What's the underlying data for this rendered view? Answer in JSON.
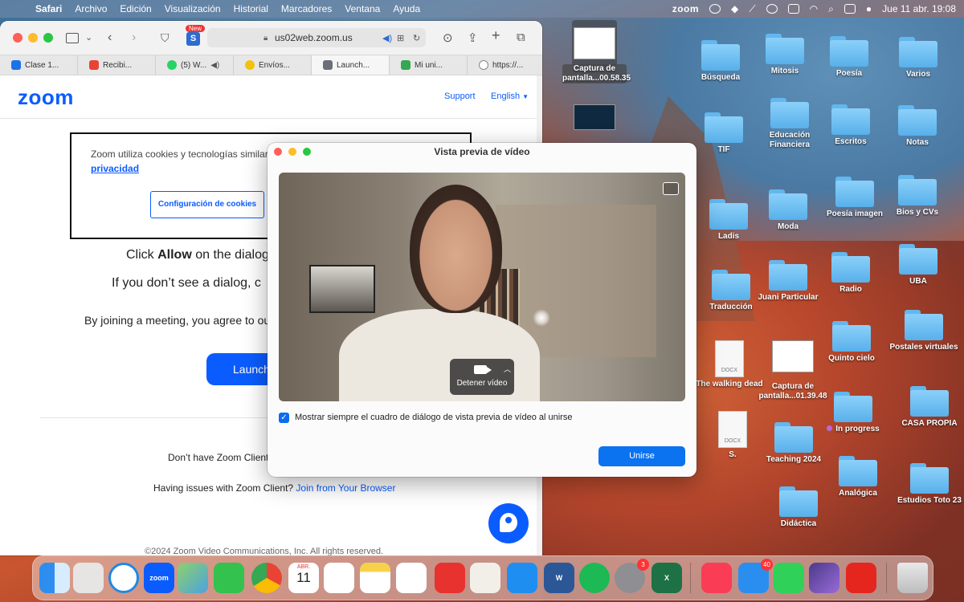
{
  "menubar": {
    "app": "Safari",
    "items": [
      "Archivo",
      "Edición",
      "Visualización",
      "Historial",
      "Marcadores",
      "Ventana",
      "Ayuda"
    ],
    "zoom_label": "zoom",
    "date_time": "Jue 11 abr.  19:08"
  },
  "safari": {
    "new_badge": "New",
    "address": "us02web.zoom.us",
    "tabs": [
      {
        "label": "Clase 1...",
        "favicon_color": "#1a73e8"
      },
      {
        "label": "Recibi...",
        "favicon_color": "#ea4335"
      },
      {
        "label": "(5) W...",
        "favicon_color": "#25d366"
      },
      {
        "label": "Envíos...",
        "favicon_color": "#f4c20d"
      },
      {
        "label": "Launch...",
        "favicon_color": "#6b6f77"
      },
      {
        "label": "Mi uni...",
        "favicon_color": "#34a853"
      },
      {
        "label": "https://...",
        "favicon_color": "#888888"
      }
    ]
  },
  "zoom_page": {
    "logo": "zoom",
    "support": "Support",
    "english": "English",
    "cookie_text": "Zoom utiliza cookies y tecnologías similares",
    "cookie_link": "privacidad",
    "cookie_button": "Configuración de cookies",
    "click_prefix": "Click ",
    "click_bold": "Allow",
    "click_suffix": " on the dialog",
    "no_dialog": "If you don’t see a dialog, c",
    "joining": "By joining a meeting, you agree to our",
    "launch": "Launch",
    "dont_have": "Don’t have Zoom Client",
    "issues_prefix": "Having issues with Zoom Client? ",
    "issues_link": "Join from Your Browser",
    "copyright": "©2024 Zoom Video Communications, Inc. All rights reserved."
  },
  "video_preview": {
    "title": "Vista previa de vídeo",
    "stop_video": "Detener vídeo",
    "always_show": "Mostrar siempre el cuadro de diálogo de vista previa de vídeo al unirse",
    "always_show_checked": true,
    "join": "Unirse"
  },
  "desktop": {
    "screenshot1": "Captura de pantalla...00.58.35",
    "screenshot2": "Captura de pantalla...01.39.48",
    "doc1_ext": "DOCX",
    "doc1": "The walking dead",
    "doc2_ext": "DOCX",
    "doc2": "S.",
    "folders": {
      "busqueda": "Búsqueda",
      "mitosis": "Mitosis",
      "poesia": "Poesía",
      "varios": "Varios",
      "tif": "TIF",
      "educacion": "Educación Financiera",
      "escritos": "Escritos",
      "notas": "Notas",
      "ladis": "Ladis",
      "moda": "Moda",
      "poesia_imagen": "Poesía imagen",
      "bios": "Bios y CVs",
      "traduccion": "Traducción",
      "juani": "Juani Particular",
      "radio": "Radio",
      "uba": "UBA",
      "quinto": "Quinto cielo",
      "postales": "Postales virtuales",
      "in_progress": "In progress",
      "casa": "CASA PROPIA",
      "teaching": "Teaching 2024",
      "analogica": "Analógica",
      "estudios": "Estudios Toto 23",
      "didactica": "Didáctica"
    }
  },
  "dock": {
    "zoom": "zoom",
    "calendar_month": "ABR.",
    "calendar_day": "11",
    "settings_badge": "3",
    "mail_badge": "40",
    "word": "W",
    "excel": "X"
  }
}
